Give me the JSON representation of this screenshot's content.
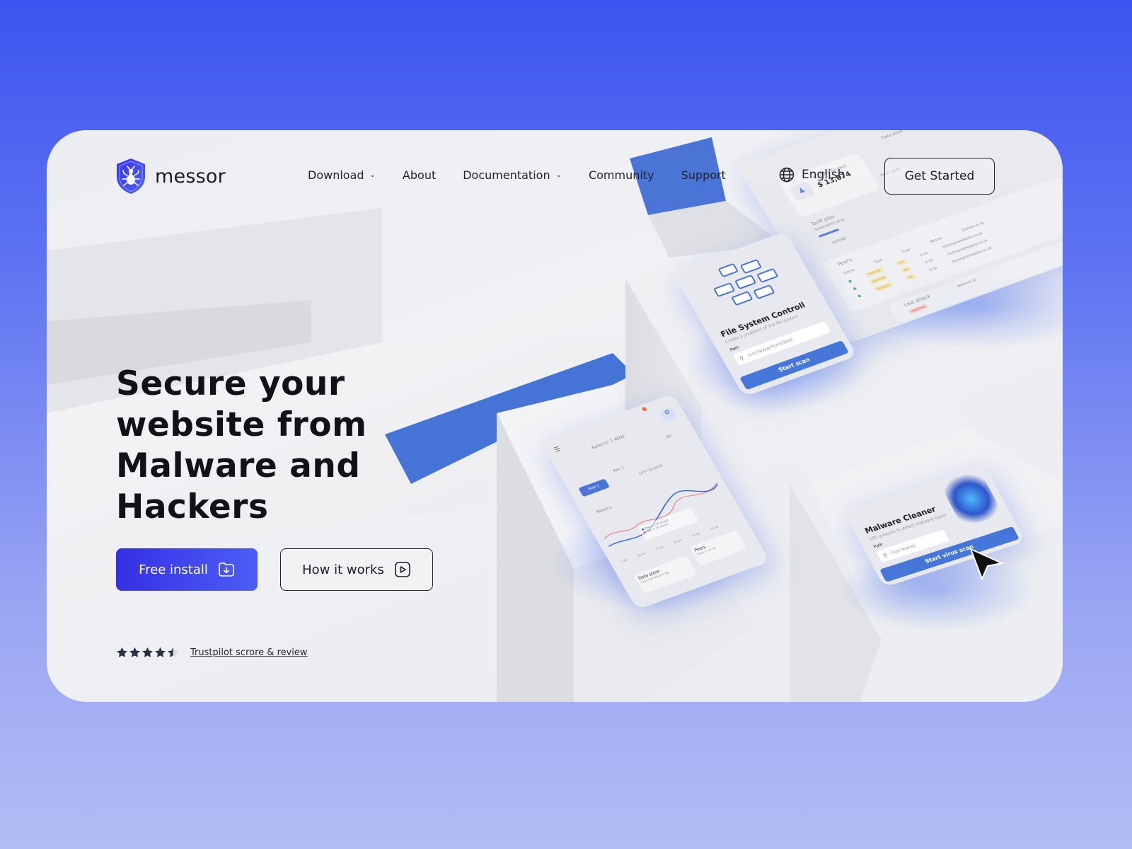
{
  "brand": {
    "name": "messor",
    "logo_icon": "shield-ant-icon",
    "accent_color": "#3d3ff0",
    "bg_gradient_top": "#3d55f0",
    "bg_gradient_bottom": "#b3bcf4"
  },
  "nav": {
    "items": [
      {
        "label": "Download",
        "has_dropdown": true
      },
      {
        "label": "About",
        "has_dropdown": false
      },
      {
        "label": "Documentation",
        "has_dropdown": true
      },
      {
        "label": "Community",
        "has_dropdown": false
      },
      {
        "label": "Support",
        "has_dropdown": false
      }
    ],
    "language": {
      "label": "English",
      "icon": "globe-icon"
    },
    "cta_label": "Get Started"
  },
  "hero": {
    "headline_lines": [
      "Secure your",
      "website from",
      "Malware and",
      "Hackers"
    ],
    "primary_button": {
      "label": "Free install",
      "icon": "folder-download-icon"
    },
    "secondary_button": {
      "label": "How it works",
      "icon": "play-icon"
    },
    "rating": {
      "stars": 4.5,
      "max": 5,
      "link_text": "Trustpilot scrore & review"
    }
  },
  "mockups": {
    "file_system": {
      "title": "File System Controll",
      "subtitle": "Create a snapshot of the file system",
      "path_label": "Path",
      "path_placeholder": "/var/www/html/test",
      "button": "Start scan"
    },
    "malware": {
      "title": "Malware Cleaner",
      "subtitle": "URL analysis to detect malware types",
      "path_label": "Path",
      "path_placeholder": "/var/www/",
      "button": "Start virus scan"
    },
    "dashboard": {
      "balance": "Balance: 1 480$",
      "filter_all": "All",
      "tabs": [
        "Peer 1",
        "Peer 2"
      ],
      "range": "LAST 30 DAYS",
      "metrics_label": "Metrics",
      "legend": [
        {
          "name": "Peer 1",
          "value": "210 attack"
        },
        {
          "name": "Peer 2",
          "value": "10 attack"
        }
      ],
      "x_ticks": [
        "1.06",
        "10.06",
        "15.06",
        "20.06",
        "25.06",
        "30.06"
      ],
      "data_store": {
        "title": "Data store",
        "sub": "Used 500 MB of 1 GB"
      },
      "peers": {
        "title": "Peers",
        "sub": "Used 12 of 30"
      }
    },
    "account": {
      "balance_label": "ACCOUNT BALANCE",
      "balance": "$ 13,074",
      "tariff": "Tariff plan",
      "tariff_sub": "Subscription ends",
      "date": "06.07.2020",
      "extend": "EXTEND",
      "data_store": "Data store",
      "peers_title": "Peer's",
      "peers_cols": [
        "Online",
        "Type",
        "Trust",
        "Version",
        "Domain or Ip"
      ],
      "peers_rows": [
        {
          "type": "PREMIUM",
          "trust": "HIG",
          "version": "0.1b",
          "domain": "mylongnamedsite.co.uk"
        },
        {
          "type": "PREMIUM",
          "trust": "MID",
          "version": "0.1b",
          "domain": "mylongnamedsite.co.uk"
        },
        {
          "type": "PREMIUM",
          "trust": "HIG",
          "version": "0.1b",
          "domain": "mylongnamedsite.co.uk"
        }
      ],
      "last_attack": "Last attack",
      "attack_type_label": "Type",
      "attack_type": "UNKNOWN",
      "network_id_label": "Network id"
    }
  }
}
